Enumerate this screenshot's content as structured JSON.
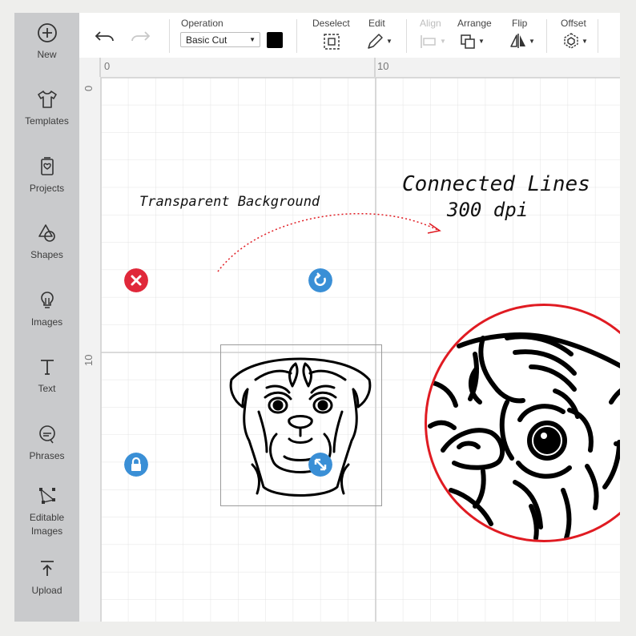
{
  "sidebar": {
    "items": [
      {
        "label": "New",
        "icon": "plus-circle-icon"
      },
      {
        "label": "Templates",
        "icon": "shirt-icon"
      },
      {
        "label": "Projects",
        "icon": "projects-icon"
      },
      {
        "label": "Shapes",
        "icon": "shapes-icon"
      },
      {
        "label": "Images",
        "icon": "lightbulb-icon"
      },
      {
        "label": "Text",
        "icon": "text-t-icon"
      },
      {
        "label": "Phrases",
        "icon": "speech-bubble-icon"
      },
      {
        "label": "Editable Images",
        "icon": "editable-images-icon"
      },
      {
        "label": "Upload",
        "icon": "upload-icon"
      }
    ]
  },
  "toolbar": {
    "undo_icon": "undo-icon",
    "redo_icon": "redo-icon",
    "operation_label": "Operation",
    "operation_value": "Basic Cut",
    "color_swatch": "#000000",
    "deselect_label": "Deselect",
    "edit_label": "Edit",
    "align_label": "Align",
    "arrange_label": "Arrange",
    "flip_label": "Flip",
    "offset_label": "Offset"
  },
  "rulers": {
    "top": [
      "0",
      "10"
    ],
    "left": [
      "0",
      "10"
    ]
  },
  "canvas": {
    "caption_left": "Transparent Background",
    "caption_right_line1": "Connected Lines",
    "caption_right_line2": "300 dpi",
    "handle_colors": {
      "delete": "#e0283a",
      "rotate": "#3a8fd6",
      "lock": "#3a8fd6",
      "resize": "#3a8fd6"
    },
    "zoom_ring_color": "#e01b22"
  }
}
